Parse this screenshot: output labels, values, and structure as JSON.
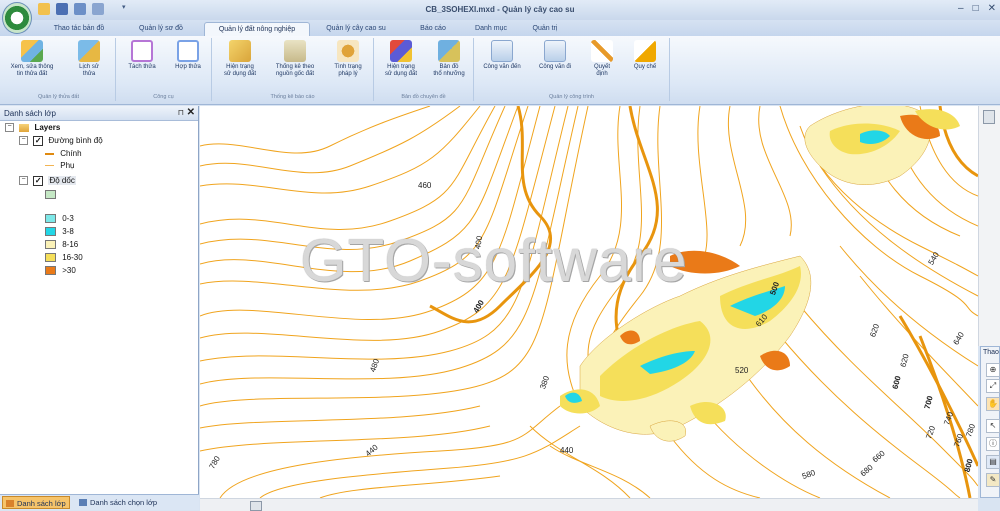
{
  "window": {
    "title": "CB_3SOHEXI.mxd - Quản lý cây cao su"
  },
  "tabs": [
    {
      "label": "Thao tác bản đồ"
    },
    {
      "label": "Quản lý sơ đồ"
    },
    {
      "label": "Quản lý đất nông nghiệp"
    },
    {
      "label": "Quản lý cây cao su"
    },
    {
      "label": "Báo cáo"
    },
    {
      "label": "Danh mục"
    },
    {
      "label": "Quản trị"
    }
  ],
  "ribbon": {
    "groups": [
      {
        "caption": "Quản lý thửa đất",
        "buttons": [
          {
            "label": "Xem, sửa thông\ntin thửa đất",
            "icon": "map-edit-icon"
          },
          {
            "label": "Lịch sử\nthửa",
            "icon": "history-icon"
          }
        ]
      },
      {
        "caption": "Công cụ",
        "buttons": [
          {
            "label": "Tách thửa",
            "icon": "split-parcel-icon"
          },
          {
            "label": "Hợp thửa",
            "icon": "merge-parcel-icon"
          }
        ]
      },
      {
        "caption": "Thống kê báo cáo",
        "buttons": [
          {
            "label": "Hiện trạng\nsử dụng đất",
            "icon": "land-use-icon"
          },
          {
            "label": "Thống kê theo\nnguồn gốc đất",
            "icon": "statistics-icon"
          },
          {
            "label": "Tình trạng\npháp lý",
            "icon": "scales-icon"
          }
        ]
      },
      {
        "caption": "Bản đồ chuyên đề",
        "buttons": [
          {
            "label": "Hiện trạng\nsử dụng đất",
            "icon": "thematic-map-icon"
          },
          {
            "label": "Bản đồ\nthổ nhưỡng",
            "icon": "soil-map-icon"
          }
        ]
      },
      {
        "caption": "Quản lý công trình",
        "buttons": [
          {
            "label": "Công văn đến",
            "icon": "incoming-doc-icon"
          },
          {
            "label": "Công văn đi",
            "icon": "outgoing-doc-icon"
          },
          {
            "label": "Quyết\nđịnh",
            "icon": "decision-icon"
          },
          {
            "label": "Quy chế",
            "icon": "regulation-icon"
          }
        ]
      }
    ]
  },
  "panel": {
    "title": "Danh sách lớp",
    "tree": {
      "root": "Layers",
      "contour_layer": "Đường bình độ",
      "contour_main": "Chính",
      "contour_sub": "Phụ",
      "slope_layer": "Độ dốc",
      "slope_classes": [
        {
          "label": "",
          "color": "#c5e8c5"
        },
        {
          "label": "0-3",
          "color": "#7de8e8"
        },
        {
          "label": "3-8",
          "color": "#22d6e6"
        },
        {
          "label": "8-16",
          "color": "#fbf2b8"
        },
        {
          "label": "16-30",
          "color": "#f5df5a"
        },
        {
          "label": ">30",
          "color": "#ea7a18"
        }
      ]
    },
    "bottom_tabs": [
      {
        "label": "Danh sách lớp"
      },
      {
        "label": "Danh sách chọn lớp"
      }
    ]
  },
  "map": {
    "watermark": "GTO-software",
    "contour_color": "#f0a41e",
    "labels": [
      "460",
      "400",
      "400",
      "480",
      "440",
      "380",
      "440",
      "780",
      "500",
      "610",
      "520",
      "540",
      "620",
      "640",
      "620",
      "600",
      "700",
      "720",
      "740",
      "760",
      "780",
      "800",
      "680",
      "660",
      "580"
    ]
  },
  "tool_window": {
    "title": "Thao"
  }
}
